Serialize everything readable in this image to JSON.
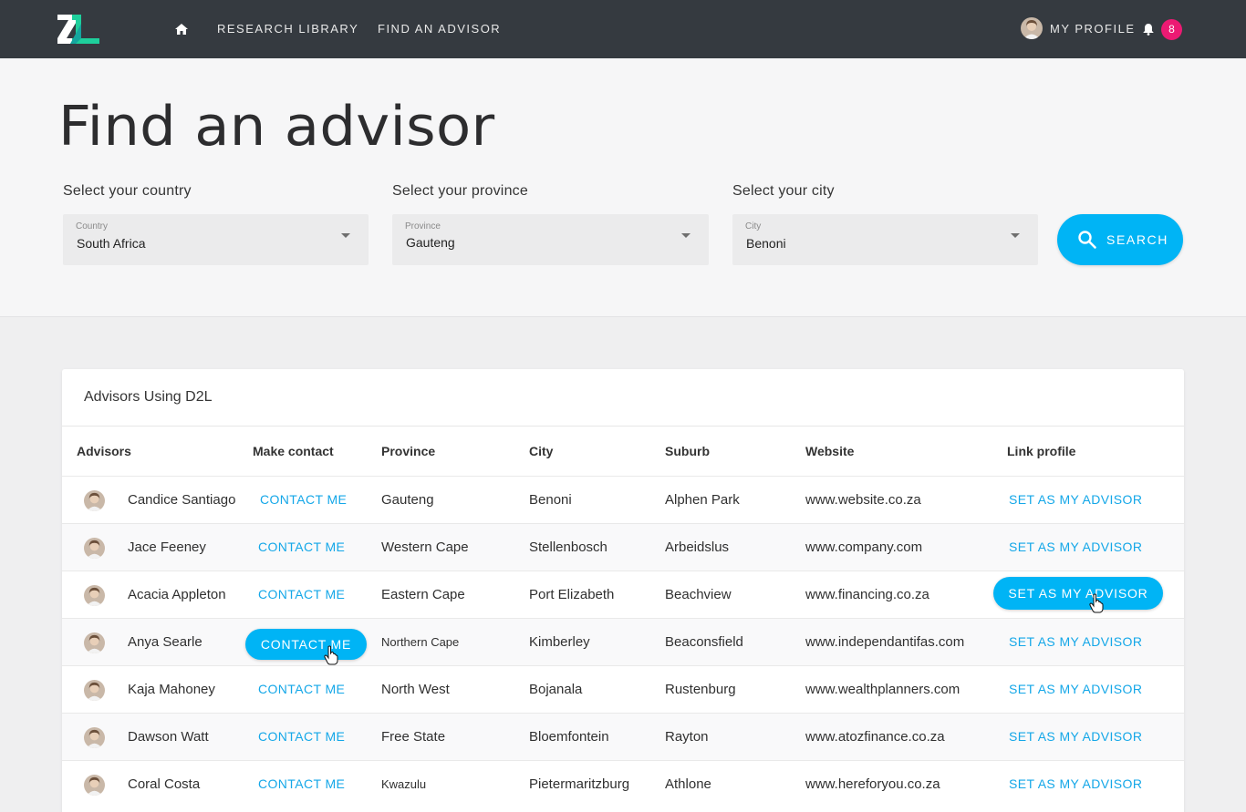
{
  "nav": {
    "research_library": "RESEARCH LIBRARY",
    "find_advisor": "FIND AN ADVISOR",
    "my_profile": "MY PROFILE",
    "notifications_count": "8",
    "colors": {
      "bar": "#353a40",
      "accent": "#00b4f5",
      "badge": "#ec1a73"
    },
    "icons": [
      "zl-logo",
      "home-icon",
      "avatar",
      "bell-icon"
    ]
  },
  "hero": {
    "title": "Find an advisor",
    "country": {
      "label": "Select your country",
      "caption": "Country",
      "value": "South Africa"
    },
    "province": {
      "label": "Select your province",
      "caption": "Province",
      "value": "Gauteng"
    },
    "city": {
      "label": "Select your city",
      "caption": "City",
      "value": "Benoni"
    },
    "search_label": "SEARCH"
  },
  "card": {
    "title": "Advisors Using D2L",
    "headers": [
      "Advisors",
      "Make contact",
      "Province",
      "City",
      "Suburb",
      "Website",
      "Link profile"
    ],
    "contact_label": "CONTACT ME",
    "advisor_label": "SET AS MY ADVISOR",
    "rows": [
      {
        "name": "Candice Santiago",
        "province": "Gauteng",
        "city": "Benoni",
        "suburb": "Alphen Park",
        "website": "www.website.co.za"
      },
      {
        "name": "Jace Feeney",
        "province": "Western Cape",
        "city": "Stellenbosch",
        "suburb": "Arbeidslus",
        "website": "www.company.com"
      },
      {
        "name": "Acacia Appleton",
        "province": "Eastern Cape",
        "city": "Port Elizabeth",
        "suburb": "Beachview",
        "website": "www.financing.co.za"
      },
      {
        "name": "Anya Searle",
        "province": "Northern Cape",
        "city": "Kimberley",
        "suburb": "Beaconsfield",
        "website": "www.independantifas.com"
      },
      {
        "name": "Kaja Mahoney",
        "province": "North West",
        "city": "Bojanala",
        "suburb": "Rustenburg",
        "website": "www.wealthplanners.com"
      },
      {
        "name": "Dawson Watt",
        "province": "Free State",
        "city": "Bloemfontein",
        "suburb": "Rayton",
        "website": "www.atozfinance.co.za"
      },
      {
        "name": "Coral Costa",
        "province": "Kwazulu",
        "city": "Pietermaritzburg",
        "suburb": "Athlone",
        "website": "www.hereforyou.co.za"
      }
    ]
  }
}
